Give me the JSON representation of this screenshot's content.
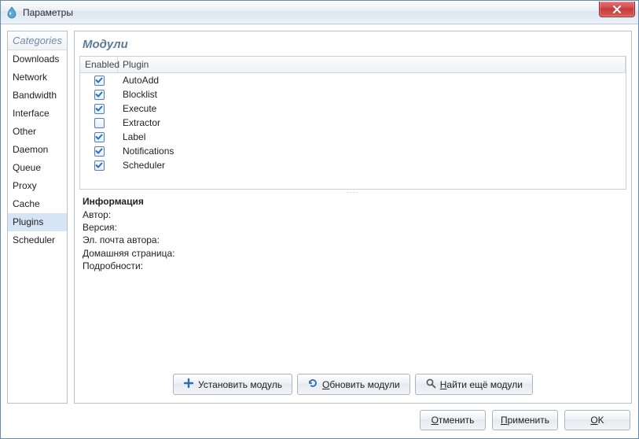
{
  "window": {
    "title": "Параметры"
  },
  "sidebar": {
    "header": "Categories",
    "items": [
      {
        "label": "Downloads",
        "selected": false
      },
      {
        "label": "Network",
        "selected": false
      },
      {
        "label": "Bandwidth",
        "selected": false
      },
      {
        "label": "Interface",
        "selected": false
      },
      {
        "label": "Other",
        "selected": false
      },
      {
        "label": "Daemon",
        "selected": false
      },
      {
        "label": "Queue",
        "selected": false
      },
      {
        "label": "Proxy",
        "selected": false
      },
      {
        "label": "Cache",
        "selected": false
      },
      {
        "label": "Plugins",
        "selected": true
      },
      {
        "label": "Scheduler",
        "selected": false
      }
    ]
  },
  "main": {
    "title": "Модули",
    "columns": {
      "enabled": "Enabled",
      "plugin": "Plugin"
    },
    "rows": [
      {
        "enabled": true,
        "name": "AutoAdd"
      },
      {
        "enabled": true,
        "name": "Blocklist"
      },
      {
        "enabled": true,
        "name": "Execute"
      },
      {
        "enabled": false,
        "name": "Extractor"
      },
      {
        "enabled": true,
        "name": "Label"
      },
      {
        "enabled": true,
        "name": "Notifications"
      },
      {
        "enabled": true,
        "name": "Scheduler"
      }
    ],
    "info": {
      "title": "Информация",
      "author_label": "Автор:",
      "version_label": "Версия:",
      "email_label": "Эл. почта автора:",
      "homepage_label": "Домашняя страница:",
      "details_label": "Подробности:"
    },
    "buttons": {
      "install": "Установить модуль",
      "rescan_prefix": "О",
      "rescan_rest": "бновить модули",
      "find_prefix": "Н",
      "find_rest": "айти ещё модули"
    }
  },
  "dialog": {
    "cancel_prefix": "О",
    "cancel_rest": "тменить",
    "apply_prefix": "П",
    "apply_rest": "рименить",
    "ok_prefix": "O",
    "ok_rest": "K"
  }
}
